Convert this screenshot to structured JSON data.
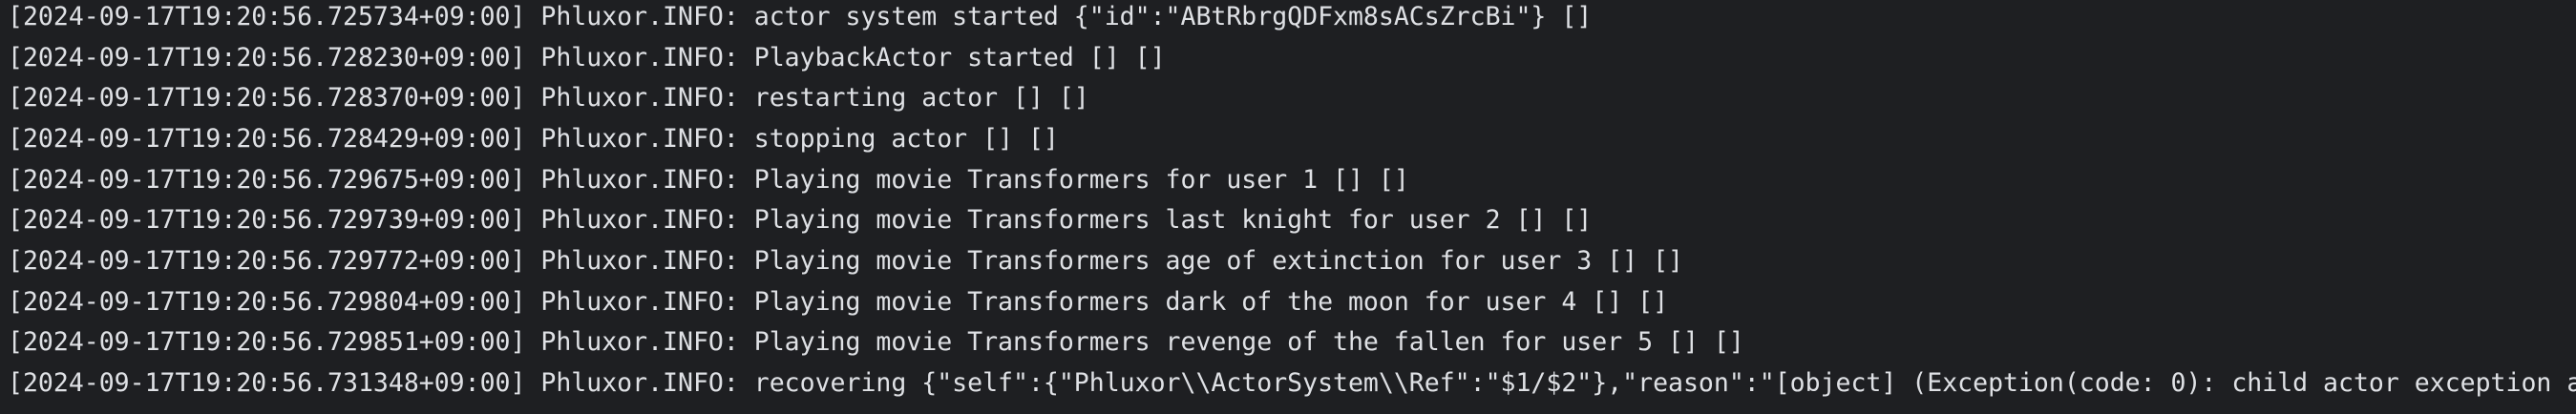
{
  "console": {
    "lines": [
      "[2024-09-17T19:20:56.725734+09:00] Phluxor.INFO: actor system started {\"id\":\"ABtRbrgQDFxm8sACsZrcBi\"} []",
      "[2024-09-17T19:20:56.728230+09:00] Phluxor.INFO: PlaybackActor started [] []",
      "[2024-09-17T19:20:56.728370+09:00] Phluxor.INFO: restarting actor [] []",
      "[2024-09-17T19:20:56.728429+09:00] Phluxor.INFO: stopping actor [] []",
      "[2024-09-17T19:20:56.729675+09:00] Phluxor.INFO: Playing movie Transformers for user 1 [] []",
      "[2024-09-17T19:20:56.729739+09:00] Phluxor.INFO: Playing movie Transformers last knight for user 2 [] []",
      "[2024-09-17T19:20:56.729772+09:00] Phluxor.INFO: Playing movie Transformers age of extinction for user 3 [] []",
      "[2024-09-17T19:20:56.729804+09:00] Phluxor.INFO: Playing movie Transformers dark of the moon for user 4 [] []",
      "[2024-09-17T19:20:56.729851+09:00] Phluxor.INFO: Playing movie Transformers revenge of the fallen for user 5 [] []",
      "[2024-09-17T19:20:56.731348+09:00] Phluxor.INFO: recovering {\"self\":{\"Phluxor\\\\ActorSystem\\\\Ref\":\"$1/$2\"},\"reason\":\"[object] (Exception(code: 0): child actor exception a"
    ],
    "text_color": "#dfe1e5",
    "background_color": "#1e1f22"
  }
}
